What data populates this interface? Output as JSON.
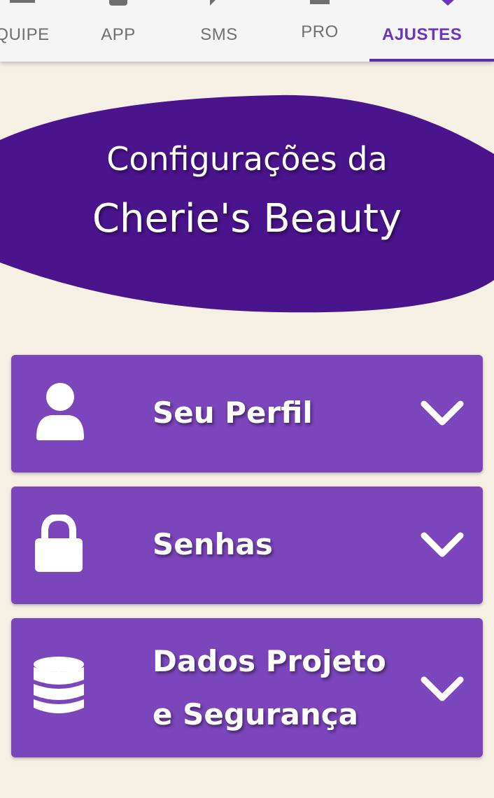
{
  "nav": {
    "tabs": [
      {
        "label": "QUIPE",
        "icon": "team-icon"
      },
      {
        "label": "APP",
        "icon": "app-icon"
      },
      {
        "label": "SMS",
        "icon": "sms-icon"
      },
      {
        "label": "PRO",
        "icon": "pro-icon"
      },
      {
        "label": "AJUSTES",
        "icon": "settings-icon",
        "active": true
      }
    ],
    "accent": "#6a35c2"
  },
  "header": {
    "line1": "Configurações da",
    "line2": "Cherie's Beauty",
    "blob_color": "#4a148c"
  },
  "sections": [
    {
      "label": "Seu Perfil",
      "icon": "user-icon"
    },
    {
      "label": "Senhas",
      "icon": "lock-icon"
    },
    {
      "label_line1": "Dados Projeto",
      "label_line2": "e Segurança",
      "icon": "database-icon"
    }
  ],
  "colors": {
    "background": "#f6efe4",
    "card": "#7b45bc"
  }
}
